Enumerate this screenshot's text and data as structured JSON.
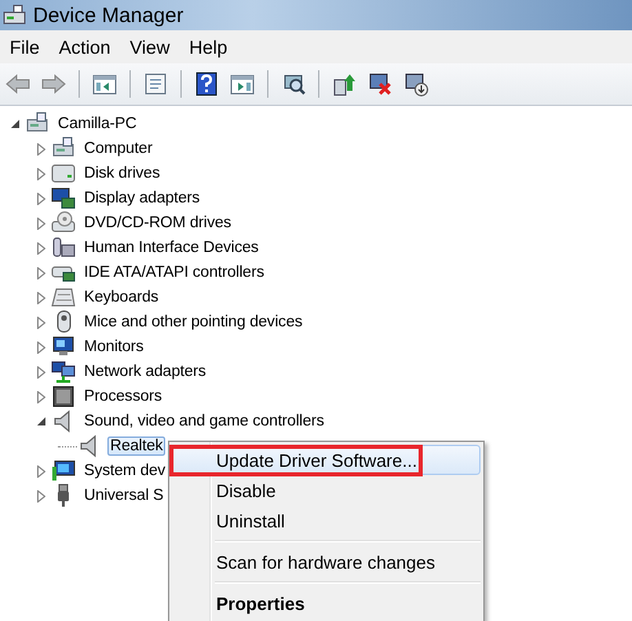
{
  "window": {
    "title": "Device Manager"
  },
  "menu_bar": [
    "File",
    "Action",
    "View",
    "Help"
  ],
  "tree": [
    {
      "label": "Camilla-PC",
      "expanded": true,
      "selected": false,
      "children": [
        {
          "label": "Computer",
          "expanded": false,
          "selected": false
        },
        {
          "label": "Disk drives",
          "expanded": false,
          "selected": false
        },
        {
          "label": "Display adapters",
          "expanded": false,
          "selected": false
        },
        {
          "label": "DVD/CD-ROM drives",
          "expanded": false,
          "selected": false
        },
        {
          "label": "Human Interface Devices",
          "expanded": false,
          "selected": false
        },
        {
          "label": "IDE ATA/ATAPI controllers",
          "expanded": false,
          "selected": false
        },
        {
          "label": "Keyboards",
          "expanded": false,
          "selected": false
        },
        {
          "label": "Mice and other pointing devices",
          "expanded": false,
          "selected": false
        },
        {
          "label": "Monitors",
          "expanded": false,
          "selected": false
        },
        {
          "label": "Network adapters",
          "expanded": false,
          "selected": false
        },
        {
          "label": "Processors",
          "expanded": false,
          "selected": false
        },
        {
          "label": "Sound, video and game controllers",
          "expanded": true,
          "selected": false,
          "children": [
            {
              "label": "Realtek",
              "selected": true
            }
          ]
        },
        {
          "label": "System dev",
          "expanded": false,
          "selected": false
        },
        {
          "label": "Universal S",
          "expanded": false,
          "selected": false
        }
      ]
    }
  ],
  "context_menu": [
    {
      "kind": "item",
      "label": "Update Driver Software...",
      "selected": true,
      "annotated": true,
      "default": false
    },
    {
      "kind": "item",
      "label": "Disable",
      "selected": false,
      "annotated": false,
      "default": false
    },
    {
      "kind": "item",
      "label": "Uninstall",
      "selected": false,
      "annotated": false,
      "default": false
    },
    {
      "kind": "separator"
    },
    {
      "kind": "item",
      "label": "Scan for hardware changes",
      "selected": false,
      "annotated": false,
      "default": false
    },
    {
      "kind": "separator"
    },
    {
      "kind": "item",
      "label": "Properties",
      "selected": false,
      "annotated": false,
      "default": true
    }
  ]
}
